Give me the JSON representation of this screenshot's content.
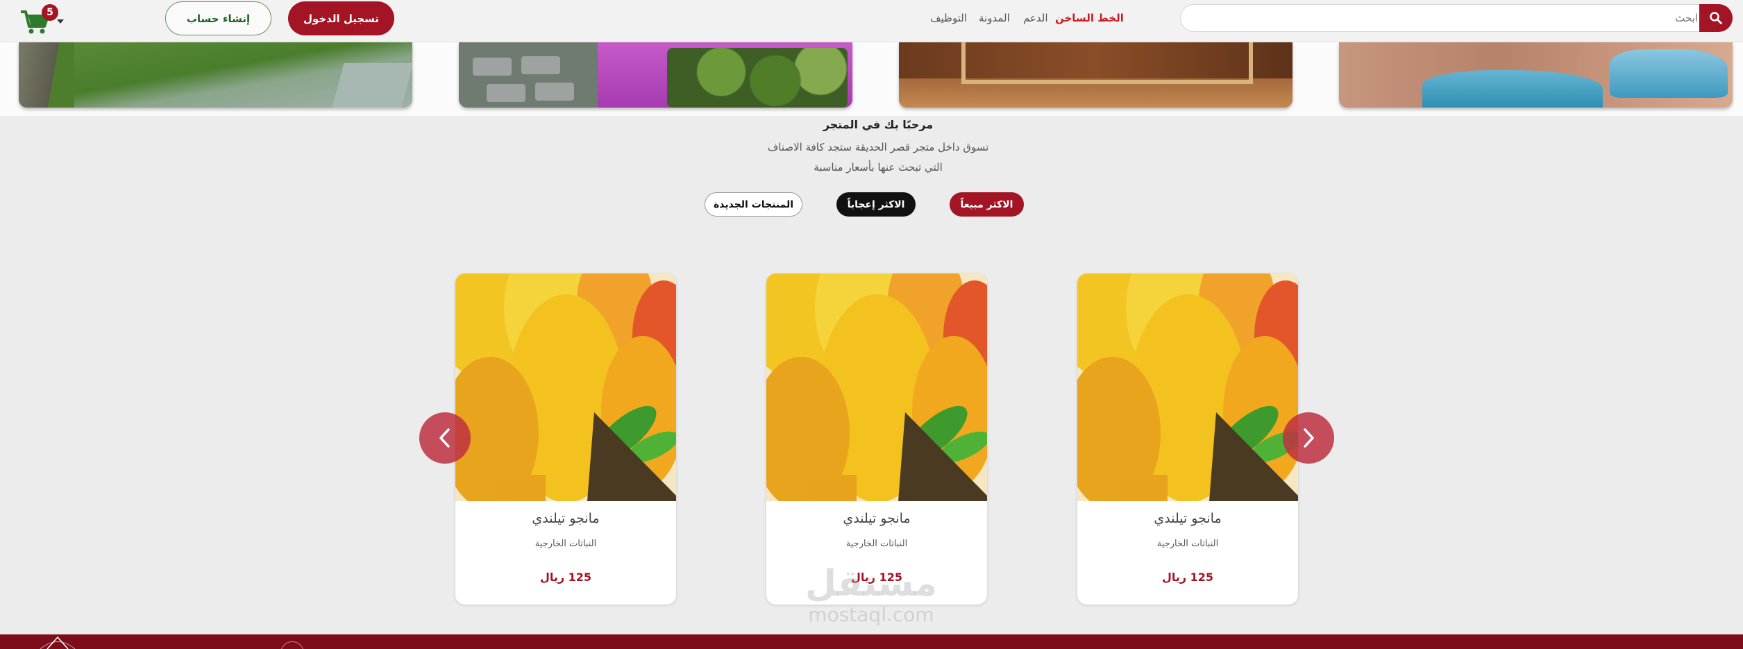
{
  "header": {
    "cart_count": "5",
    "signup_label": "إنشاء حساب",
    "login_label": "تسجيل الدخول",
    "nav": {
      "hotline": "الخط الساخن",
      "support": "الدعم",
      "blog": "المدونة",
      "jobs": "التوظيف"
    },
    "search": {
      "placeholder": "ابحث"
    }
  },
  "welcome": {
    "title": "مرحبًا بك في المتجر",
    "desc_line1": "تسوق داخل متجر قصر الحديقة ستجد كافة الاصناف",
    "desc_line2": "التي تبحث عنها بأسعار مناسبة"
  },
  "tabs": {
    "best_selling": "الاكثر مبيعاً",
    "most_liked": "الاكثر إعجاباً",
    "new_products": "المنتجات الجديدة"
  },
  "products": [
    {
      "name": "مانجو تيلندي",
      "category": "النباتات الخارجية",
      "price": "125 ريال"
    },
    {
      "name": "مانجو تيلندي",
      "category": "النباتات الخارجية",
      "price": "125 ريال"
    },
    {
      "name": "مانجو تيلندي",
      "category": "النباتات الخارجية",
      "price": "125 ريال"
    }
  ],
  "watermark": {
    "arabic": "مستقل",
    "latin": "mostaql.com"
  },
  "icons": {
    "cart": "shopping-cart-icon",
    "search": "search-icon",
    "prev": "chevron-left-icon",
    "next": "chevron-right-icon"
  },
  "colors": {
    "brand": "#a31424",
    "accent_green": "#1f6f1f",
    "footer": "#7e0d1b"
  }
}
